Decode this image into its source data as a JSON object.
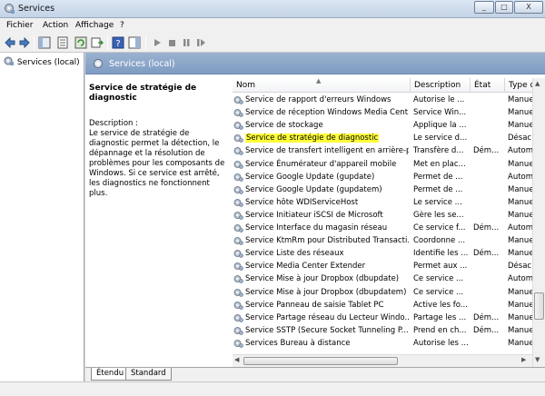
{
  "window": {
    "title": "Services",
    "minimize": "_",
    "maximize": "□",
    "close": "X"
  },
  "menu": [
    "Fichier",
    "Action",
    "Affichage",
    "?"
  ],
  "tree": {
    "root": "Services (local)"
  },
  "panel": {
    "title": "Services (local)"
  },
  "detail": {
    "title": "Service de stratégie de diagnostic",
    "desc_label": "Description :",
    "desc_text": "Le service de stratégie de diagnostic permet la détection, le dépannage et la résolution de problèmes pour les composants de Windows. Si ce service est arrêté, les diagnostics ne fonctionnent plus."
  },
  "columns": [
    "Nom",
    "Description",
    "État",
    "Type d"
  ],
  "rows": [
    {
      "name": "Service de rapport d'erreurs Windows",
      "desc": "Autorise le ...",
      "state": "",
      "type": "Manue"
    },
    {
      "name": "Service de réception Windows Media Cent...",
      "desc": "Service Win...",
      "state": "",
      "type": "Manue"
    },
    {
      "name": "Service de stockage",
      "desc": "Applique la ...",
      "state": "",
      "type": "Manue"
    },
    {
      "name": "Service de stratégie de diagnostic",
      "desc": "Le service d...",
      "state": "",
      "type": "Désac",
      "highlight": true
    },
    {
      "name": "Service de transfert intelligent en arrière-pl...",
      "desc": "Transfère d...",
      "state": "Dém...",
      "type": "Autom"
    },
    {
      "name": "Service Énumérateur d'appareil mobile",
      "desc": "Met en plac...",
      "state": "",
      "type": "Manue"
    },
    {
      "name": "Service Google Update (gupdate)",
      "desc": "Permet de ...",
      "state": "",
      "type": "Autom"
    },
    {
      "name": "Service Google Update (gupdatem)",
      "desc": "Permet de ...",
      "state": "",
      "type": "Manue"
    },
    {
      "name": "Service hôte WDIServiceHost",
      "desc": "Le service ...",
      "state": "",
      "type": "Manue"
    },
    {
      "name": "Service Initiateur iSCSI de Microsoft",
      "desc": "Gère les se...",
      "state": "",
      "type": "Manue"
    },
    {
      "name": "Service Interface du magasin réseau",
      "desc": "Ce service f...",
      "state": "Dém...",
      "type": "Autom"
    },
    {
      "name": "Service KtmRm pour Distributed Transacti...",
      "desc": "Coordonne ...",
      "state": "",
      "type": "Manue"
    },
    {
      "name": "Service Liste des réseaux",
      "desc": "Identifie les ...",
      "state": "Dém...",
      "type": "Manue"
    },
    {
      "name": "Service Media Center Extender",
      "desc": "Permet aux ...",
      "state": "",
      "type": "Désac"
    },
    {
      "name": "Service Mise à jour Dropbox (dbupdate)",
      "desc": "Ce service ...",
      "state": "",
      "type": "Autom"
    },
    {
      "name": "Service Mise à jour Dropbox (dbupdatem)",
      "desc": "Ce service ...",
      "state": "",
      "type": "Manue"
    },
    {
      "name": "Service Panneau de saisie Tablet PC",
      "desc": "Active les fo...",
      "state": "",
      "type": "Manue"
    },
    {
      "name": "Service Partage réseau du Lecteur Windo...",
      "desc": "Partage les ...",
      "state": "Dém...",
      "type": "Manue"
    },
    {
      "name": "Service SSTP (Secure Socket Tunneling P...",
      "desc": "Prend en ch...",
      "state": "Dém...",
      "type": "Manue"
    },
    {
      "name": "Services Bureau à distance",
      "desc": "Autorise les ...",
      "state": "",
      "type": "Manue"
    }
  ],
  "tabs": [
    "Étendu",
    "Standard"
  ],
  "colors": {
    "highlight": "#ffff3a",
    "header_band": "#8aa6c9"
  }
}
